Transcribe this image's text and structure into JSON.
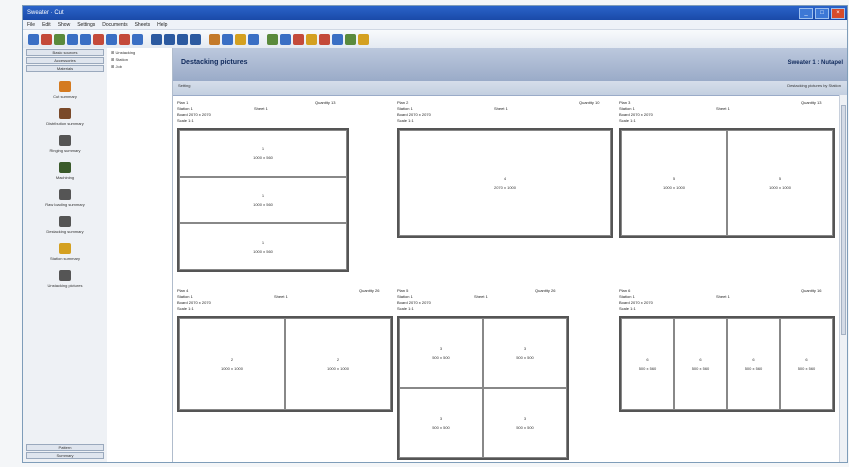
{
  "window": {
    "title": "Sweater · Cut"
  },
  "menu": [
    "File",
    "Edit",
    "Show",
    "Settings",
    "Documents",
    "Sheets",
    "Help"
  ],
  "toolbar_icons": [
    {
      "name": "open-icon",
      "color": "#3a6fc4"
    },
    {
      "name": "new-icon",
      "color": "#c44a3a"
    },
    {
      "name": "grid-icon",
      "color": "#5a8a3c"
    },
    {
      "name": "print-icon",
      "color": "#3a6fc4"
    },
    {
      "name": "copy-icon",
      "color": "#3a6fc4"
    },
    {
      "name": "cut-icon",
      "color": "#c44a3a"
    },
    {
      "name": "search-icon",
      "color": "#3a6fc4"
    },
    {
      "name": "report-icon",
      "color": "#c44a3a"
    },
    {
      "name": "chart-icon",
      "color": "#3a6fc4"
    },
    {
      "name": "first-icon",
      "color": "#2c5aa0"
    },
    {
      "name": "prev-icon",
      "color": "#2c5aa0"
    },
    {
      "name": "next-icon",
      "color": "#2c5aa0"
    },
    {
      "name": "last-icon",
      "color": "#2c5aa0"
    },
    {
      "name": "settings-icon",
      "color": "#c47a2a"
    },
    {
      "name": "list-icon",
      "color": "#3a6fc4"
    },
    {
      "name": "help-icon",
      "color": "#d4a020"
    },
    {
      "name": "info-icon",
      "color": "#3a6fc4"
    },
    {
      "name": "export-icon",
      "color": "#5a8a3c"
    },
    {
      "name": "import-icon",
      "color": "#3a6fc4"
    },
    {
      "name": "color-icon",
      "color": "#c44a3a"
    },
    {
      "name": "tool-icon",
      "color": "#d4a020"
    },
    {
      "name": "measure-icon",
      "color": "#c44a3a"
    },
    {
      "name": "layout-icon",
      "color": "#3a6fc4"
    },
    {
      "name": "user-icon",
      "color": "#5a8a3c"
    },
    {
      "name": "star-icon",
      "color": "#d4a020"
    }
  ],
  "left_top_buttons": [
    "Basic sources",
    "Accessories",
    "Materials"
  ],
  "nav_items": [
    {
      "name": "nav-item-cut-summary",
      "label": "Cut summary",
      "color": "#d47a20"
    },
    {
      "name": "nav-item-distribution-summary",
      "label": "Distribution summary",
      "color": "#7a4a2a"
    },
    {
      "name": "nav-item-ringing-summary",
      "label": "Ringing summary",
      "color": "#555"
    },
    {
      "name": "nav-item-machining",
      "label": "Machining",
      "color": "#3a5a2a"
    },
    {
      "name": "nav-item-material-loading-summary",
      "label": "Raw loading summary",
      "color": "#555"
    },
    {
      "name": "nav-item-destacking-summary",
      "label": "Destacking summary",
      "color": "#555"
    },
    {
      "name": "nav-item-station-summary",
      "label": "Station summary",
      "color": "#d4a020"
    },
    {
      "name": "nav-item-unstacking-pictures",
      "label": "Unstacking pictures",
      "color": "#555"
    }
  ],
  "left_bottom_buttons": [
    "Pattern",
    "Summary"
  ],
  "tree": [
    "Unstacking",
    "Station",
    "Job"
  ],
  "main": {
    "title": "Destacking pictures",
    "title_right": "Sweater 1 : Nutapel",
    "sub_left": "Setting",
    "sub_right": "Destacking pictures by Station"
  },
  "plans": [
    {
      "name": "Plan 1",
      "qty": "Quantity 13",
      "station": "Station 1",
      "sheet": "Sheet 1",
      "board": "Board 2070 x 2070",
      "scale": "Scale 1:1",
      "cols": 1,
      "rows": 3,
      "pieces": [
        {
          "n": "1",
          "size": "1000 x 560"
        },
        {
          "n": "1",
          "size": "1000 x 560"
        },
        {
          "n": "1",
          "size": "1000 x 560"
        }
      ]
    },
    {
      "name": "Plan 2",
      "qty": "Quantity 10",
      "station": "Station 1",
      "sheet": "Sheet 1",
      "board": "Board 2070 x 2070",
      "scale": "Scale 1:1",
      "cols": 1,
      "rows": 1,
      "pieces": [
        {
          "n": "4",
          "size": "2070 x 1000"
        }
      ]
    },
    {
      "name": "Plan 3",
      "qty": "Quantity 13",
      "station": "Station 1",
      "sheet": "Sheet 1",
      "board": "Board 2070 x 2070",
      "scale": "Scale 1:1",
      "cols": 2,
      "rows": 1,
      "pieces": [
        {
          "n": "5",
          "size": "1000 x 1000"
        },
        {
          "n": "5",
          "size": "1000 x 1000"
        }
      ]
    },
    {
      "name": "Plan 4",
      "qty": "Quantity 26",
      "station": "Station 1",
      "sheet": "Sheet 1",
      "board": "Board 2070 x 2070",
      "scale": "Scale 1:1",
      "cols": 2,
      "rows": 1,
      "pieces": [
        {
          "n": "2",
          "size": "1000 x 1000"
        },
        {
          "n": "2",
          "size": "1000 x 1000"
        }
      ]
    },
    {
      "name": "Plan 5",
      "qty": "Quantity 26",
      "station": "Station 1",
      "sheet": "Sheet 1",
      "board": "Board 2070 x 2070",
      "scale": "Scale 1:1",
      "cols": 2,
      "rows": 2,
      "pieces": [
        {
          "n": "3",
          "size": "500 x 500"
        },
        {
          "n": "3",
          "size": "500 x 500"
        },
        {
          "n": "3",
          "size": "500 x 500"
        },
        {
          "n": "3",
          "size": "500 x 500"
        }
      ]
    },
    {
      "name": "Plan 6",
      "qty": "Quantity 16",
      "station": "Station 1",
      "sheet": "Sheet 1",
      "board": "Board 2070 x 2070",
      "scale": "Scale 1:1",
      "cols": 4,
      "rows": 1,
      "pieces": [
        {
          "n": "6",
          "size": "500 x 560"
        },
        {
          "n": "6",
          "size": "500 x 560"
        },
        {
          "n": "6",
          "size": "500 x 560"
        },
        {
          "n": "6",
          "size": "500 x 560"
        }
      ]
    }
  ]
}
